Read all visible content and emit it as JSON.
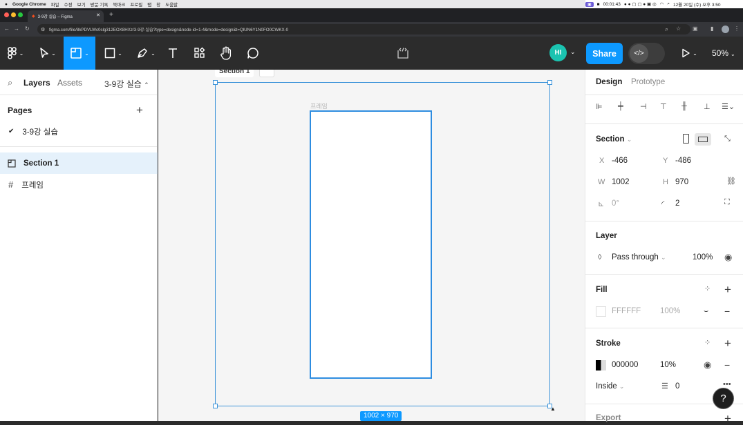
{
  "menubar": {
    "app": "Google Chrome",
    "menus": [
      "파일",
      "수정",
      "보기",
      "방문 기록",
      "북마크",
      "프로필",
      "탭",
      "창",
      "도움말"
    ],
    "record_time": "00:01:43",
    "clock": "12월 20일 (수) 오후 3:50"
  },
  "browser": {
    "tab_title": "3-9강 실습 – Figma",
    "url": "figma.com/file/8kPDVLWc0slg312EOX8HXz/3-9강-실습?type=design&node-id=1-4&mode=design&t=QlUN6Y1N0FO0CWKX-0"
  },
  "toolbar": {
    "avatar_initials": "HI",
    "share_label": "Share",
    "zoom_label": "50%",
    "accent": "#0d99ff"
  },
  "left_panel": {
    "tab_layers": "Layers",
    "tab_assets": "Assets",
    "page_selector": "3-9강 실습",
    "pages_heading": "Pages",
    "pages": [
      {
        "label": "3-9강 실습",
        "checked": true
      }
    ],
    "layers": [
      {
        "label": "Section 1",
        "icon": "section-icon",
        "selected": true
      },
      {
        "label": "프레임",
        "icon": "frame-hash-icon",
        "selected": false
      }
    ]
  },
  "canvas": {
    "section_label": "Section 1",
    "frame_label": "프레임",
    "dimension_label": "1002 × 970"
  },
  "right_panel": {
    "tab_design": "Design",
    "tab_prototype": "Prototype",
    "section_heading": "Section",
    "x_label": "X",
    "x_value": "-466",
    "y_label": "Y",
    "y_value": "-486",
    "w_label": "W",
    "w_value": "1002",
    "h_label": "H",
    "h_value": "970",
    "rotation_value": "0°",
    "radius_value": "2",
    "layer_heading": "Layer",
    "blend_mode": "Pass through",
    "layer_opacity": "100%",
    "fill_heading": "Fill",
    "fill_hex": "FFFFFF",
    "fill_opacity": "100%",
    "stroke_heading": "Stroke",
    "stroke_hex": "000000",
    "stroke_opacity": "10%",
    "stroke_position": "Inside",
    "stroke_weight": "0",
    "export_heading": "Export"
  },
  "help_label": "?"
}
